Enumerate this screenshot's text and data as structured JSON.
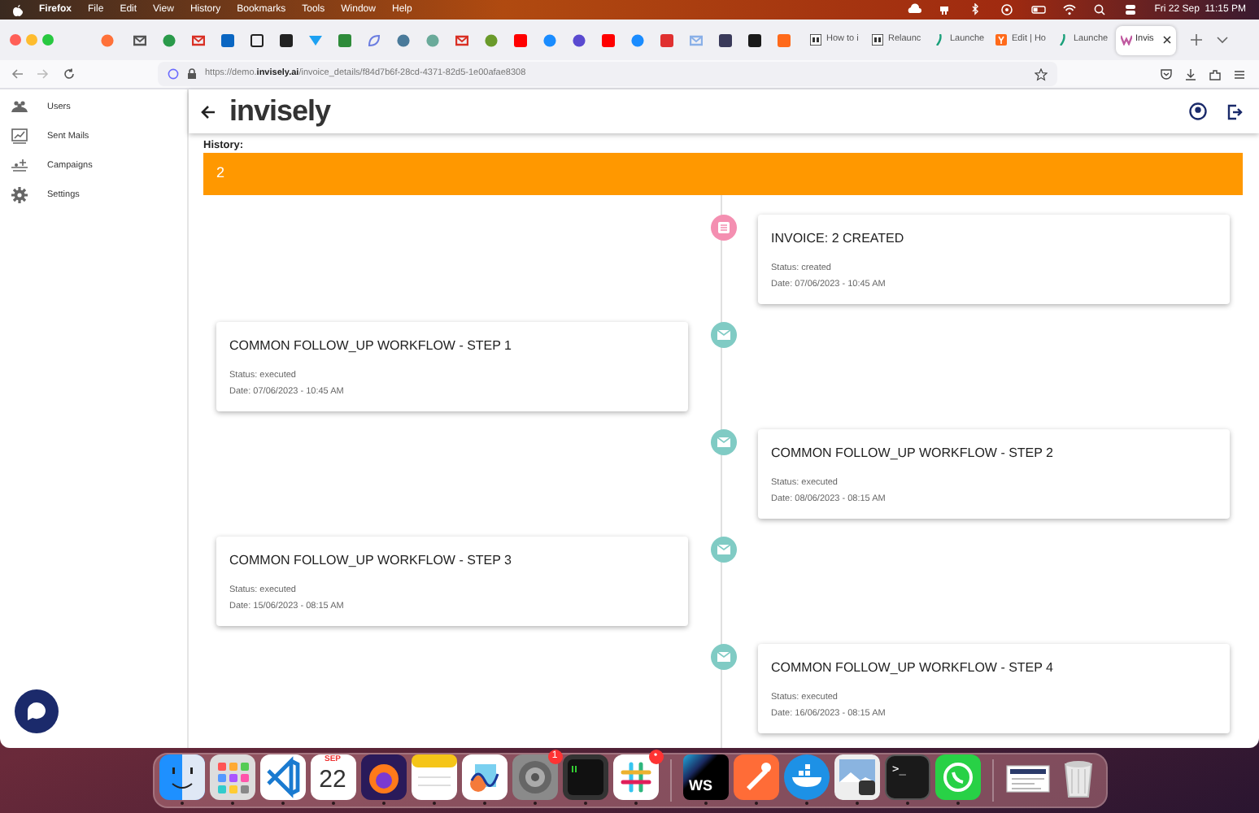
{
  "menu_bar": {
    "app": "Firefox",
    "menus": [
      "File",
      "Edit",
      "View",
      "History",
      "Bookmarks",
      "Tools",
      "Window",
      "Help"
    ],
    "clock": "Fri 22 Sep  11:15 PM"
  },
  "browser": {
    "tabs": [
      {
        "label": "How to i",
        "selected": false,
        "kind": "doc"
      },
      {
        "label": "Relaunc",
        "selected": false,
        "kind": "doc"
      },
      {
        "label": "Launche",
        "selected": false,
        "kind": "leaf"
      },
      {
        "label": "Edit | Ho",
        "selected": false,
        "kind": "y"
      },
      {
        "label": "Launche",
        "selected": false,
        "kind": "leaf"
      },
      {
        "label": "Invis",
        "selected": true,
        "kind": "logo"
      }
    ],
    "url": "https://demo.**invisely.ai**/invoice_details/f84d7b6f-28cd-4371-82d5-1e00afae8308"
  },
  "sidebar": {
    "items": [
      {
        "label": "Users",
        "kind": "users"
      },
      {
        "label": "Sent Mails",
        "kind": "chart"
      },
      {
        "label": "Campaigns",
        "kind": "campaign"
      },
      {
        "label": "Settings",
        "kind": "gear"
      }
    ]
  },
  "header": {
    "logo": "invisely"
  },
  "history": {
    "label": "History:",
    "value": "2"
  },
  "events": [
    {
      "title": "INVOICE: 2 CREATED",
      "status": "Status: created",
      "date": "Date: 07/06/2023 - 10:45 AM",
      "kind": "invoice"
    },
    {
      "title": "COMMON FOLLOW_UP WORKFLOW - STEP 1",
      "status": "Status: executed",
      "date": "Date: 07/06/2023 - 10:45 AM",
      "kind": "workflow"
    },
    {
      "title": "COMMON FOLLOW_UP WORKFLOW - STEP 2",
      "status": "Status: executed",
      "date": "Date: 08/06/2023 - 08:15 AM",
      "kind": "workflow"
    },
    {
      "title": "COMMON FOLLOW_UP WORKFLOW - STEP 3",
      "status": "Status: executed",
      "date": "Date: 15/06/2023 - 08:15 AM",
      "kind": "workflow"
    },
    {
      "title": "COMMON FOLLOW_UP WORKFLOW - STEP 4",
      "status": "Status: executed",
      "date": "Date: 16/06/2023 - 08:15 AM",
      "kind": "workflow"
    }
  ],
  "dock": [
    {
      "kind": "face",
      "running": true
    },
    {
      "kind": "grid",
      "running": true
    },
    {
      "kind": "ribbon",
      "running": true
    },
    {
      "kind": "calendar",
      "month": "SEP",
      "day": "22",
      "running": true
    },
    {
      "kind": "globe",
      "running": true
    },
    {
      "kind": "notepad",
      "running": true
    },
    {
      "kind": "scribble",
      "running": true
    },
    {
      "kind": "gear",
      "badge": "1",
      "running": true
    },
    {
      "kind": "console",
      "running": true
    },
    {
      "kind": "hash",
      "badge": "•",
      "running": true
    },
    {
      "kind": "sep"
    },
    {
      "kind": "ws",
      "label": "WS",
      "running": true
    },
    {
      "kind": "rocket",
      "running": true
    },
    {
      "kind": "whale",
      "running": true
    },
    {
      "kind": "photo",
      "running": true
    },
    {
      "kind": "terminal",
      "label": ">_",
      "running": true
    },
    {
      "kind": "phone",
      "running": true
    },
    {
      "kind": "sep"
    },
    {
      "kind": "document"
    },
    {
      "kind": "trash"
    }
  ]
}
